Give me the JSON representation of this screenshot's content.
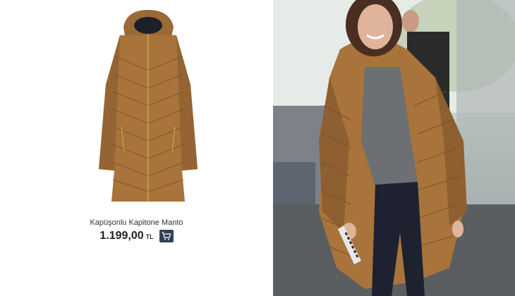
{
  "product": {
    "title": "Kapüşonlu Kapitone Manto",
    "price": "1.199,00",
    "currency": "TL"
  },
  "icons": {
    "cart": "shopping-cart-icon"
  },
  "colors": {
    "coat": "#a8743b",
    "cart_button": "#2f4354"
  }
}
